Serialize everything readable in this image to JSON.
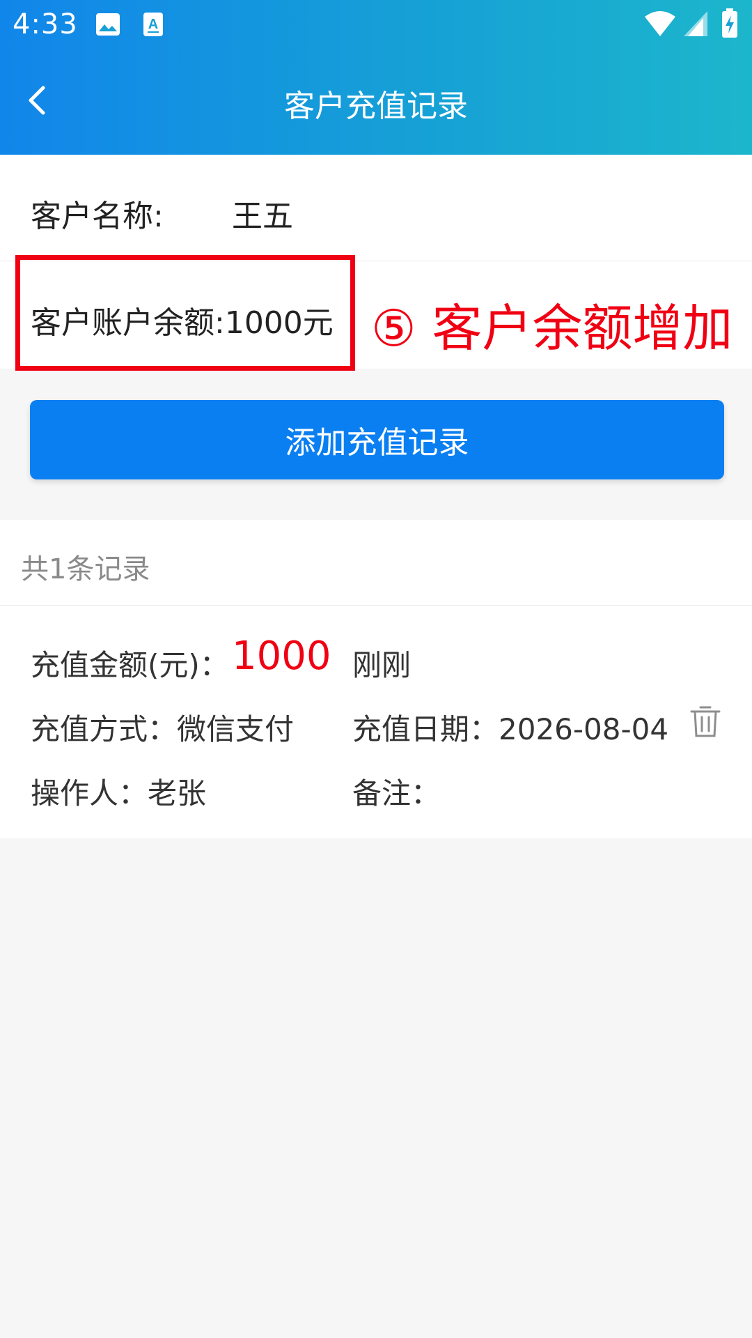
{
  "status_bar": {
    "time": "4:33",
    "left_icons": [
      "image-icon",
      "font-a-icon"
    ],
    "right_icons": [
      "wifi-icon",
      "signal-icon",
      "battery-charging-icon"
    ]
  },
  "nav": {
    "back_icon": "chevron-left-icon",
    "title": "客户充值记录"
  },
  "customer": {
    "name_label": "客户名称:",
    "name_value": "王五",
    "balance_text": "客户账户余额:1000元"
  },
  "annotation": {
    "text": "⑤ 客户余额增加",
    "color": "#f00013"
  },
  "actions": {
    "add_label": "添加充值记录"
  },
  "records": {
    "count_text": "共1条记录",
    "items": [
      {
        "amount_label": "充值金额(元)：",
        "amount_value": "1000",
        "time_text": "刚刚",
        "method_text": "充值方式：微信支付",
        "date_text": "充值日期：2026-08-04",
        "operator_text": "操作人：老张",
        "note_text": "备注：",
        "delete_icon": "trash-icon"
      }
    ]
  },
  "colors": {
    "header_start": "#1186ea",
    "header_end": "#1cb6cc",
    "button": "#0a7ff2",
    "accent_red": "#f00013"
  }
}
